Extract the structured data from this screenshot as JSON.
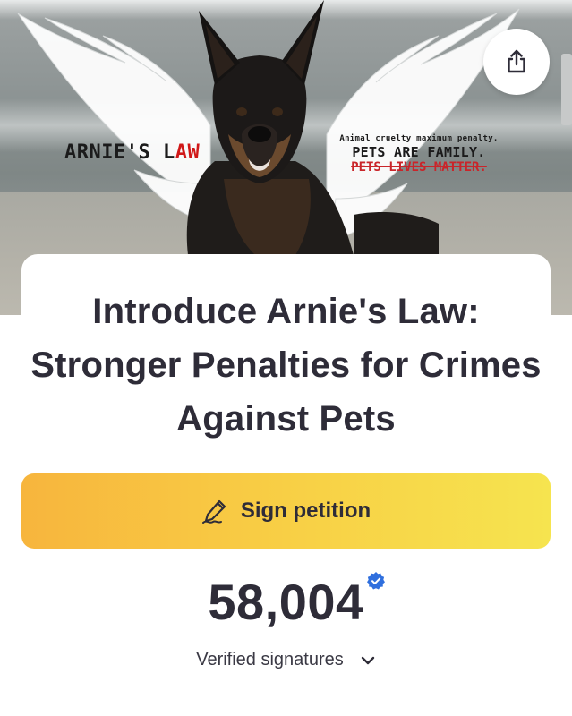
{
  "hero": {
    "caption_left_black": "ARNIE'S L",
    "caption_left_red": "AW",
    "caption_right_small": "Animal cruelty maximum penalty.",
    "caption_right_big": "PETS ARE FAMILY.",
    "caption_right_red": "PETS LIVES MATTER."
  },
  "share": {
    "icon": "share-icon"
  },
  "petition": {
    "title": "Introduce Arnie's Law: Stronger Penalties for Crimes Against Pets",
    "sign_label": "Sign petition",
    "sign_icon": "pen-icon",
    "signature_count": "58,004",
    "verified_icon": "verified-badge-icon",
    "verified_label": "Verified signatures",
    "expand_icon": "chevron-down-icon"
  },
  "colors": {
    "button_gradient_start": "#f7b53d",
    "button_gradient_end": "#f6e44f",
    "verified_blue": "#2f6fde",
    "text_dark": "#2e2c38",
    "caption_red": "#d01818"
  }
}
